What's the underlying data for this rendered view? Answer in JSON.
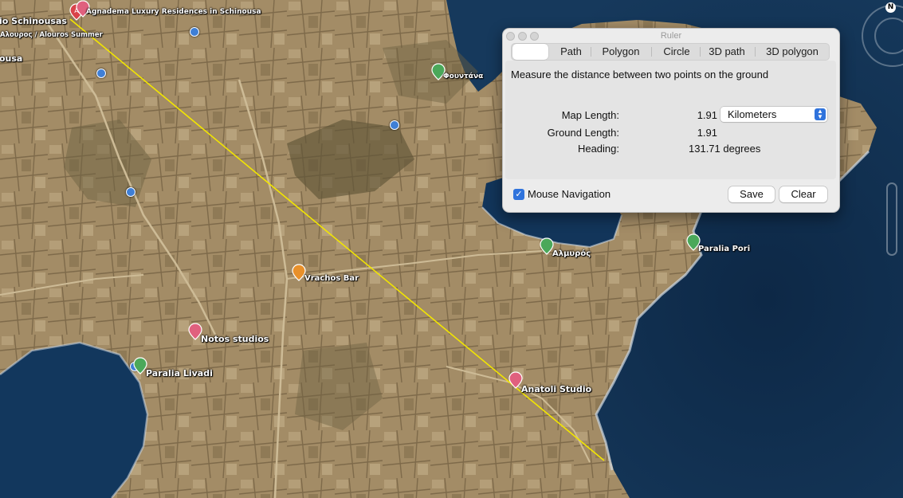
{
  "map": {
    "places": [
      {
        "name": "Agnadema Luxury Residences in Schinousa"
      },
      {
        "name": "io Schinousas"
      },
      {
        "name": "Αλουρος / Alouros Summer"
      },
      {
        "name": "ousa"
      },
      {
        "name": "Φουντάνα"
      },
      {
        "name": "Αλμυρός"
      },
      {
        "name": "Paralia Pori"
      },
      {
        "name": "Vrachos Bar"
      },
      {
        "name": "Notos studios"
      },
      {
        "name": "Paralia Livadi"
      },
      {
        "name": "Anatoli Studio"
      }
    ],
    "compass_north": "N",
    "colors": {
      "ruler_line": "#f2e600",
      "sea": "#0f2b4a",
      "land": "#a08a64"
    }
  },
  "ruler": {
    "title": "Ruler",
    "tabs": [
      "",
      "Path",
      "Polygon",
      "Circle",
      "3D path",
      "3D polygon"
    ],
    "active_tab": 0,
    "description": "Measure the distance between two points on the ground",
    "map_length_label": "Map Length:",
    "map_length_value": "1.91",
    "unit": "Kilometers",
    "ground_length_label": "Ground Length:",
    "ground_length_value": "1.91",
    "heading_label": "Heading:",
    "heading_value": "131.71 degrees",
    "mouse_navigation_label": "Mouse Navigation",
    "mouse_navigation_checked": true,
    "save_label": "Save",
    "clear_label": "Clear"
  }
}
